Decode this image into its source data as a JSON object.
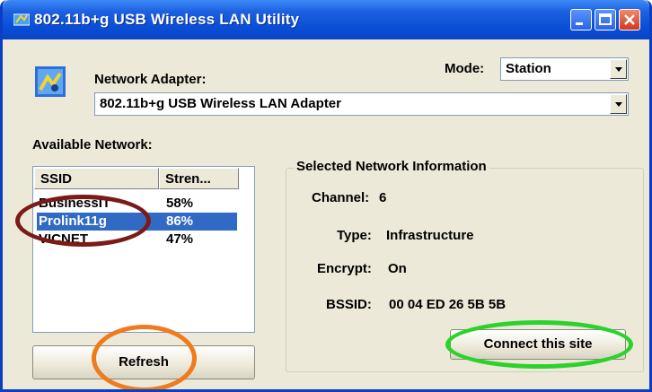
{
  "window": {
    "title": "802.11b+g USB Wireless LAN Utility"
  },
  "adapter": {
    "label": "Network Adapter:",
    "selected": "802.11b+g USB Wireless LAN Adapter"
  },
  "mode": {
    "label": "Mode:",
    "selected": "Station"
  },
  "available": {
    "label": "Available Network:",
    "columns": [
      "SSID",
      "Stren..."
    ],
    "rows": [
      {
        "ssid": "BusinessIT",
        "strength": "58%"
      },
      {
        "ssid": "Prolink11g",
        "strength": "86%"
      },
      {
        "ssid": "VICNET",
        "strength": "47%"
      }
    ],
    "selected_ssid": "Prolink11g"
  },
  "info": {
    "group_title": "Selected Network Information",
    "channel_label": "Channel:",
    "channel_value": "6",
    "type_label": "Type:",
    "type_value": "Infrastructure",
    "encrypt_label": "Encrypt:",
    "encrypt_value": "On",
    "bssid_label": "BSSID:",
    "bssid_value": "00 04 ED 26 5B 5B"
  },
  "buttons": {
    "refresh": "Refresh",
    "connect": "Connect this site"
  },
  "highlights": {
    "ssid_oval_color": "#7b1a16",
    "refresh_oval_color": "#f07a1c",
    "connect_oval_color": "#2cd22c"
  },
  "colors": {
    "titlebar": "#0a4ed6",
    "selection": "#316ac5",
    "window_bg": "#ece9d8"
  }
}
